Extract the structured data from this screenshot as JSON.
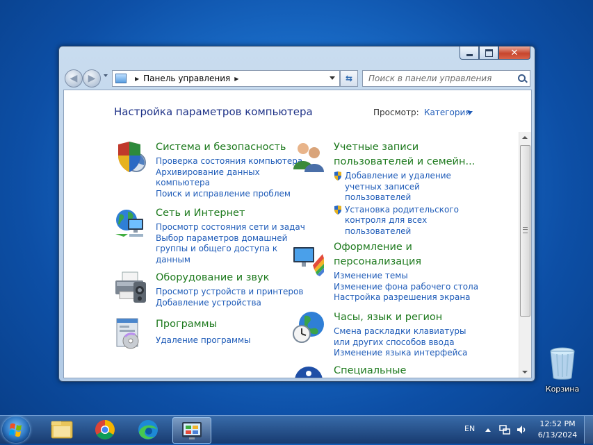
{
  "window": {
    "address": {
      "location": "Панель управления"
    },
    "search": {
      "placeholder": "Поиск в панели управления"
    }
  },
  "page": {
    "title": "Настройка параметров компьютера",
    "view_by_label": "Просмотр:",
    "view_by_value": "Категория"
  },
  "categories": {
    "system": {
      "title": "Система и безопасность",
      "links": [
        "Проверка состояния компьютера",
        "Архивирование данных",
        "компьютера",
        "Поиск и исправление проблем"
      ]
    },
    "network": {
      "title": "Сеть и Интернет",
      "links": [
        "Просмотр состояния сети и задач",
        "Выбор параметров домашней",
        "группы и общего доступа к",
        "данным"
      ]
    },
    "hardware": {
      "title": "Оборудование и звук",
      "links": [
        "Просмотр устройств и принтеров",
        "Добавление устройства"
      ]
    },
    "programs": {
      "title": "Программы",
      "links": [
        "Удаление программы"
      ]
    },
    "users": {
      "title_line1": "Учетные записи",
      "title_line2": "пользователей и семейн...",
      "links": [
        "Добавление и удаление",
        "учетных записей",
        "пользователей",
        "Установка родительского",
        "контроля для всех",
        "пользователей"
      ]
    },
    "appearance": {
      "title_line1": "Оформление и",
      "title_line2": "персонализация",
      "links": [
        "Изменение темы",
        "Изменение фона рабочего стола",
        "Настройка разрешения экрана"
      ]
    },
    "clock": {
      "title": "Часы, язык и регион",
      "links": [
        "Смена раскладки клавиатуры",
        "или других способов ввода",
        "Изменение языка интерфейса"
      ]
    },
    "access": {
      "title": "Специальные"
    }
  },
  "desktop": {
    "recycle_bin_label": "Корзина"
  },
  "taskbar": {
    "language": "EN",
    "time": "12:52 PM",
    "date": "6/13/2024",
    "items": [
      "explorer",
      "chrome",
      "edge",
      "control-panel"
    ]
  },
  "colors": {
    "link": "#1e5bb8",
    "category_title": "#1e7a1e",
    "page_title": "#1e3287"
  }
}
